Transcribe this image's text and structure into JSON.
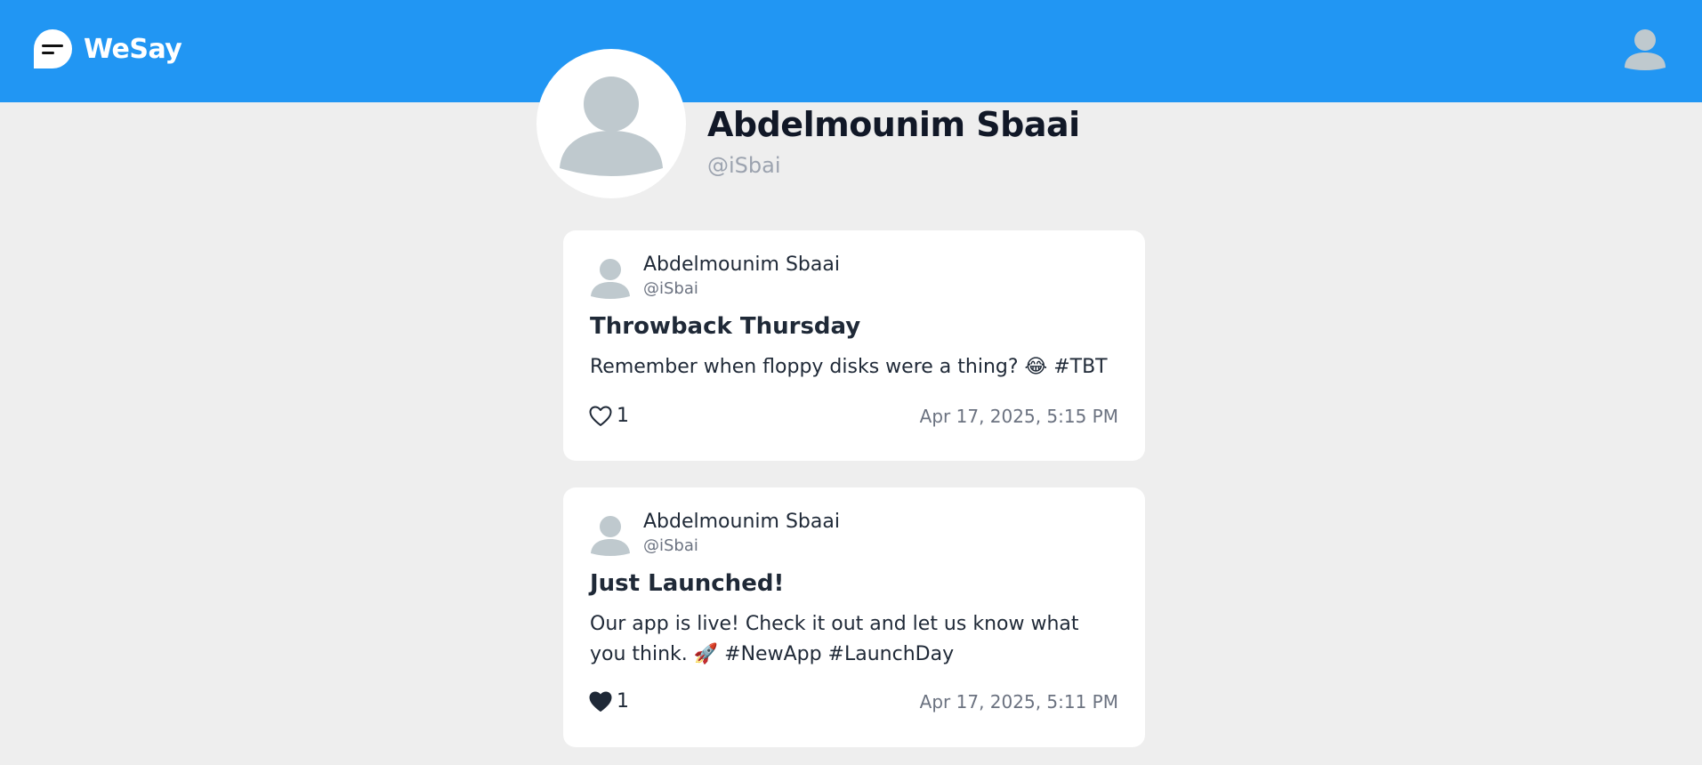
{
  "colors": {
    "header_bg": "#2196f3",
    "page_bg": "#eeeeee",
    "card_bg": "#ffffff",
    "avatar_gray": "#bfc9ce",
    "muted_text": "#9ca3af"
  },
  "header": {
    "brand_name": "WeSay",
    "logo_icon": "chat-bubble-lines-icon",
    "account_icon": "user-avatar-icon"
  },
  "profile": {
    "name": "Abdelmounim Sbaai",
    "handle": "@iSbai",
    "avatar_icon": "default-user-avatar-icon"
  },
  "posts": [
    {
      "author": "Abdelmounim Sbaai",
      "handle": "@iSbai",
      "title": "Throwback Thursday",
      "body": "Remember when floppy disks were a thing? 😂 #TBT",
      "likes": "1",
      "liked": false,
      "like_icon": "heart-outline-icon",
      "timestamp": "Apr 17, 2025, 5:15 PM"
    },
    {
      "author": "Abdelmounim Sbaai",
      "handle": "@iSbai",
      "title": "Just Launched!",
      "body": "Our app is live! Check it out and let us know what you think. 🚀 #NewApp #LaunchDay",
      "likes": "1",
      "liked": true,
      "like_icon": "heart-filled-icon",
      "timestamp": "Apr 17, 2025, 5:11 PM"
    }
  ]
}
